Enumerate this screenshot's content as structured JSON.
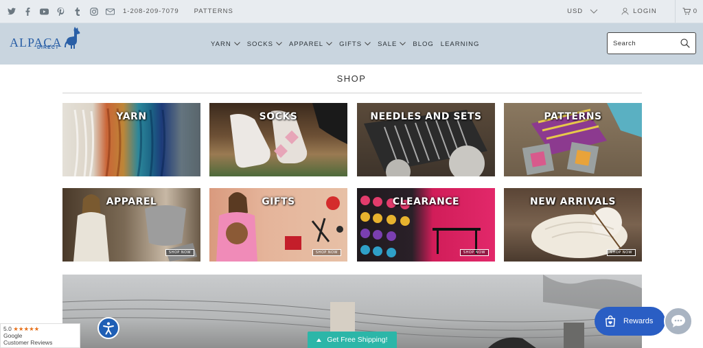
{
  "topbar": {
    "social_icons": [
      "twitter-icon",
      "facebook-icon",
      "youtube-icon",
      "pinterest-icon",
      "tumblr-icon",
      "instagram-icon",
      "email-icon"
    ],
    "phone": "1-208-209-7079",
    "patterns_link": "PATTERNS",
    "currency": "USD",
    "login": "LOGIN",
    "cart_count": "0"
  },
  "header": {
    "logo_word": "ALPACA",
    "logo_sub": "DIRECT",
    "nav": [
      {
        "label": "YARN",
        "dropdown": true
      },
      {
        "label": "SOCKS",
        "dropdown": true
      },
      {
        "label": "APPAREL",
        "dropdown": true
      },
      {
        "label": "GIFTS",
        "dropdown": true
      },
      {
        "label": "SALE",
        "dropdown": true
      },
      {
        "label": "BLOG",
        "dropdown": false
      },
      {
        "label": "LEARNING",
        "dropdown": false
      }
    ],
    "search_placeholder": "Search"
  },
  "shop": {
    "title": "SHOP",
    "tiles": [
      {
        "label": "YARN",
        "shop_now": ""
      },
      {
        "label": "SOCKS",
        "shop_now": ""
      },
      {
        "label": "NEEDLES AND SETS",
        "shop_now": ""
      },
      {
        "label": "PATTERNS",
        "shop_now": ""
      },
      {
        "label": "APPAREL",
        "shop_now": "SHOP NOW"
      },
      {
        "label": "GIFTS",
        "shop_now": "SHOP NOW"
      },
      {
        "label": "CLEARANCE",
        "shop_now": "SHOP NOW"
      },
      {
        "label": "NEW ARRIVALS",
        "shop_now": "SHOP NOW"
      }
    ]
  },
  "widgets": {
    "rating": "5.0",
    "stars": "★★★★★",
    "review_source": "Google",
    "review_label": "Customer Reviews",
    "shipping": "Get Free Shipping!",
    "rewards": "Rewards"
  },
  "colors": {
    "topbar_bg": "#e8ecf0",
    "header_bg": "#c9d5df",
    "brand_blue": "#2a5fa6",
    "shipping_teal": "#2cb6a8",
    "rewards_blue": "#2a5ec4"
  }
}
